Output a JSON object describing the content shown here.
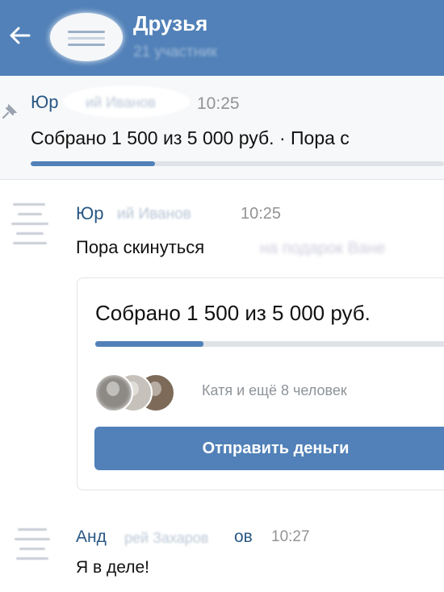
{
  "header": {
    "title": "Друзья",
    "subtitle": "21 участник",
    "back_icon": "arrow-left-icon",
    "accent": "#5181b8"
  },
  "pinned": {
    "author_visible": "Юр",
    "author_blurred": "ий Иванов",
    "time": "10:25",
    "text": "Собрано 1 500 из 5 000 руб. · Пора с",
    "icon": "pin-icon",
    "progress_fraction": 0.3
  },
  "messages": [
    {
      "author_visible": "Юр",
      "author_blurred": "ий Иванов",
      "time": "10:25",
      "text": "Пора скинуться",
      "text_blurred": "на подарок Ване",
      "card": {
        "amount_text": "Собрано 1 500 из 5 000 руб.",
        "progress_fraction": 0.3,
        "contributors_text": "Катя и ещё 8 человек",
        "button_label": "Отправить деньги"
      }
    },
    {
      "author_visible": "Анд",
      "author_blurred": "рей Захаров",
      "author_end": "ов",
      "time": "10:27",
      "text": "Я в деле!"
    }
  ]
}
